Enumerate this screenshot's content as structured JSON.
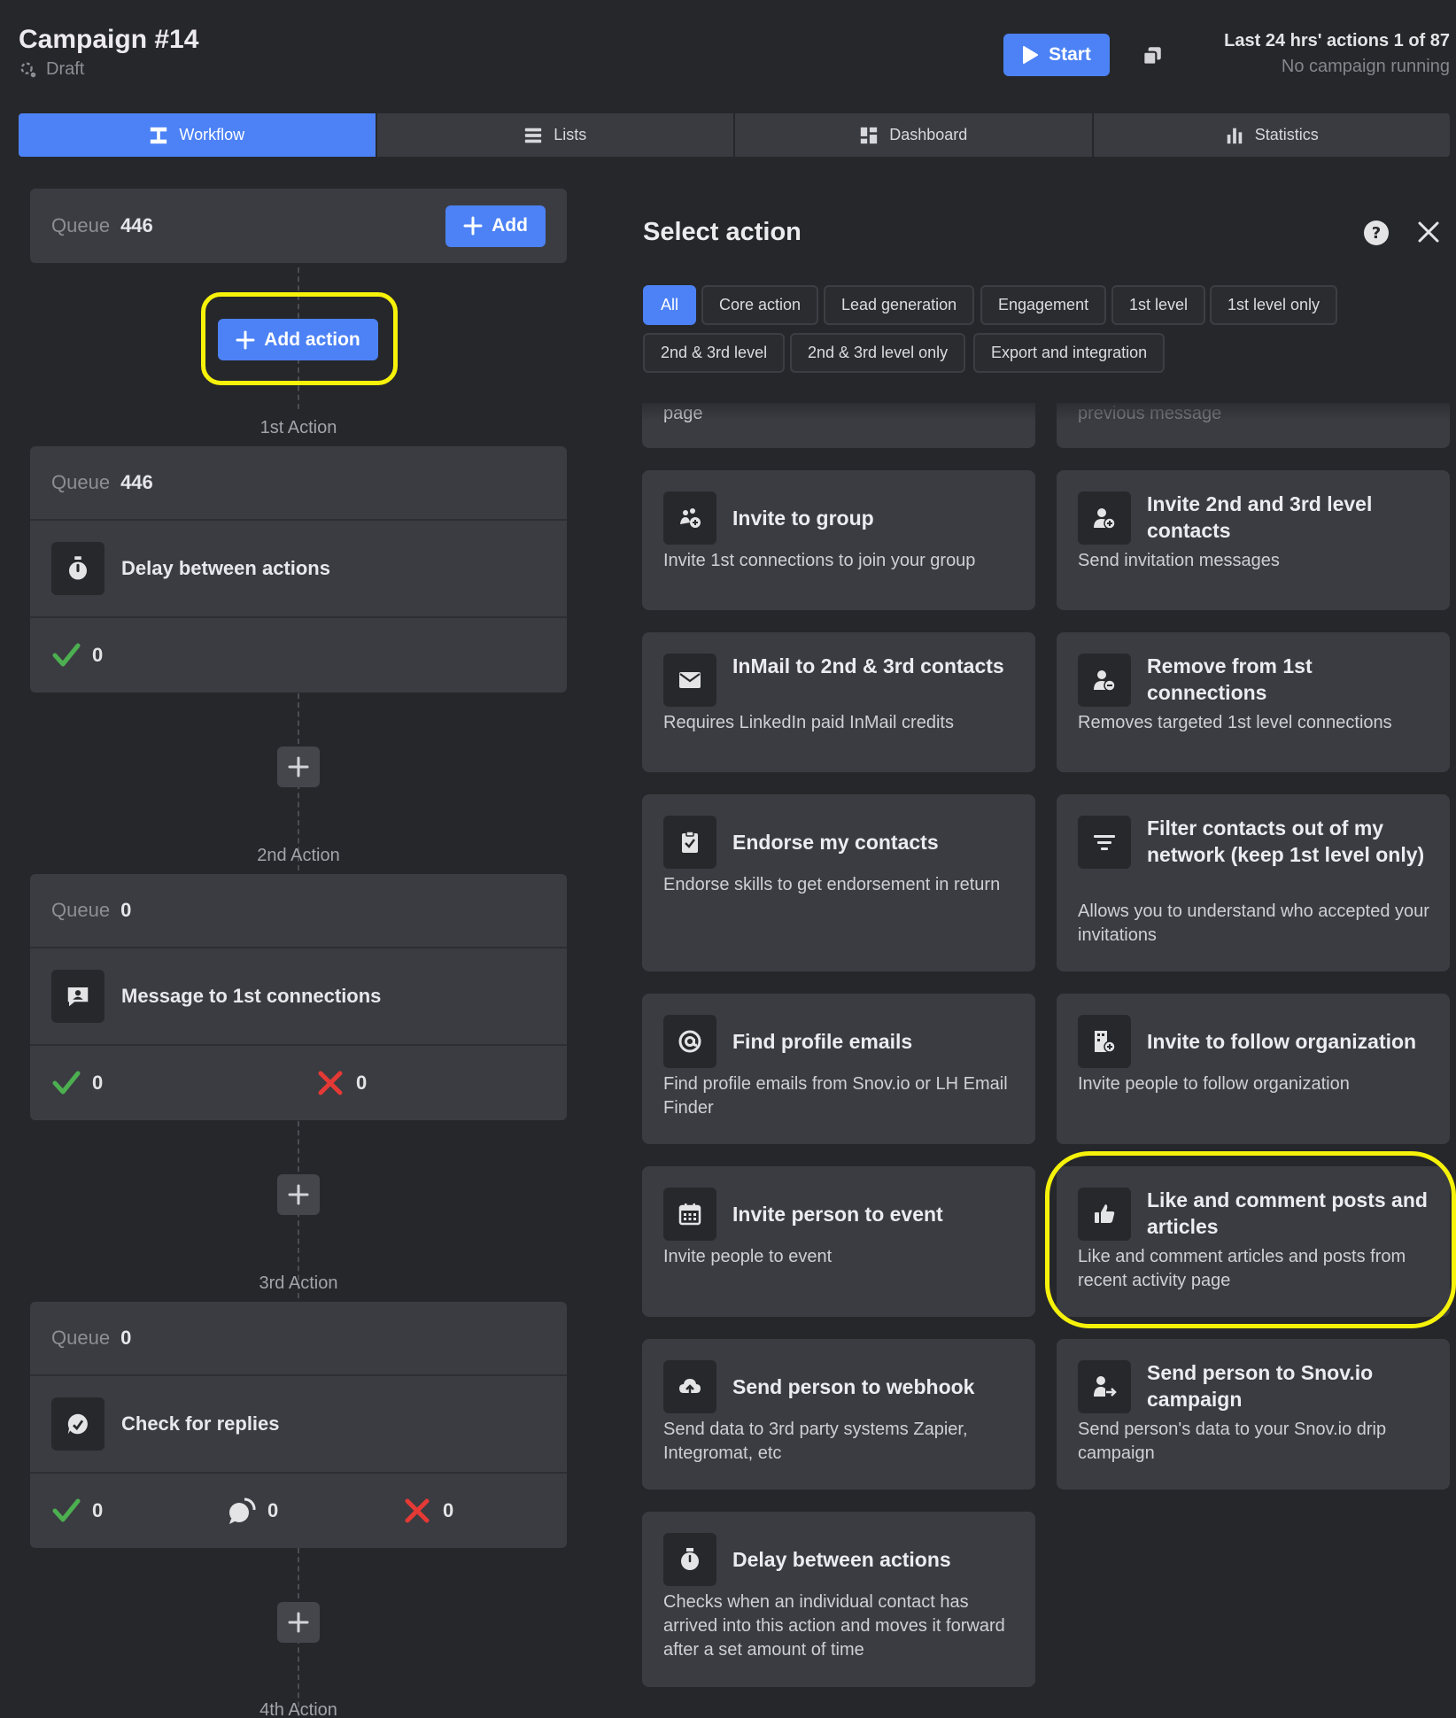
{
  "header": {
    "title": "Campaign #14",
    "status": "Draft",
    "start_label": "Start",
    "actions_prefix": "Last 24 hrs' actions",
    "actions_count": "1 of 87",
    "running_status": "No campaign running"
  },
  "tabs": [
    {
      "label": "Workflow",
      "icon": "workflow-icon",
      "active": true
    },
    {
      "label": "Lists",
      "icon": "list-icon",
      "active": false
    },
    {
      "label": "Dashboard",
      "icon": "dashboard-icon",
      "active": false
    },
    {
      "label": "Statistics",
      "icon": "statistics-icon",
      "active": false
    }
  ],
  "workflow": {
    "top_queue": {
      "label": "Queue",
      "value": "446",
      "add_label": "Add"
    },
    "add_action_label": "Add action",
    "actions": [
      {
        "step": "1st Action",
        "queue_label": "Queue",
        "queue": "446",
        "name": "Delay between actions",
        "icon": "stopwatch-icon",
        "success": "0"
      },
      {
        "step": "2nd Action",
        "queue_label": "Queue",
        "queue": "0",
        "name": "Message to 1st connections",
        "icon": "message-icon",
        "success": "0",
        "failed": "0"
      },
      {
        "step": "3rd Action",
        "queue_label": "Queue",
        "queue": "0",
        "name": "Check for replies",
        "icon": "reply-check-icon",
        "success": "0",
        "replied": "0",
        "failed": "0"
      }
    ],
    "next_step": "4th Action"
  },
  "panel": {
    "title": "Select action",
    "filters": [
      "All",
      "Core action",
      "Lead generation",
      "Engagement",
      "1st level",
      "1st level only",
      "2nd & 3rd level",
      "2nd & 3rd level only",
      "Export and integration"
    ],
    "partial_left": "page",
    "partial_right": "previous message",
    "cards": [
      {
        "title": "Invite to group",
        "desc": "Invite 1st connections to join your group",
        "icon": "group-add-icon"
      },
      {
        "title": "Invite 2nd and 3rd level contacts",
        "desc": "Send invitation messages",
        "icon": "person-add-icon"
      },
      {
        "title": "InMail to 2nd & 3rd contacts",
        "desc": "Requires LinkedIn paid InMail credits",
        "icon": "mail-icon"
      },
      {
        "title": "Remove from 1st connections",
        "desc": "Removes targeted 1st level connections",
        "icon": "person-remove-icon"
      },
      {
        "title": "Endorse my contacts",
        "desc": "Endorse skills to get endorsement in return",
        "icon": "endorse-icon"
      },
      {
        "title": "Filter contacts out of my network (keep 1st level only)",
        "desc": "Allows you to understand who accepted your invitations",
        "icon": "filter-icon"
      },
      {
        "title": "Find profile emails",
        "desc": "Find profile emails from Snov.io or LH Email Finder",
        "icon": "at-sign-icon"
      },
      {
        "title": "Invite to follow organization",
        "desc": "Invite people to follow organization",
        "icon": "organization-add-icon"
      },
      {
        "title": "Invite person to event",
        "desc": "Invite people to event",
        "icon": "calendar-icon"
      },
      {
        "title": "Like and comment posts and articles",
        "desc": "Like and comment articles and posts from recent activity page",
        "icon": "thumbs-up-icon"
      },
      {
        "title": "Send person to webhook",
        "desc": "Send data to 3rd party systems Zapier, Integromat, etc",
        "icon": "cloud-upload-icon"
      },
      {
        "title": "Send person to Snov.io campaign",
        "desc": "Send person's data to your Snov.io drip campaign",
        "icon": "person-send-icon"
      },
      {
        "title": "Delay between actions",
        "desc": "Checks when an individual contact has arrived into this action and moves it forward after a set amount of time",
        "icon": "stopwatch-icon"
      }
    ]
  },
  "colors": {
    "accent": "#4c82f5",
    "highlight": "#f6f20a",
    "success": "#4caf50",
    "error": "#e53935",
    "background": "#26272b",
    "card": "#3b3c41"
  }
}
